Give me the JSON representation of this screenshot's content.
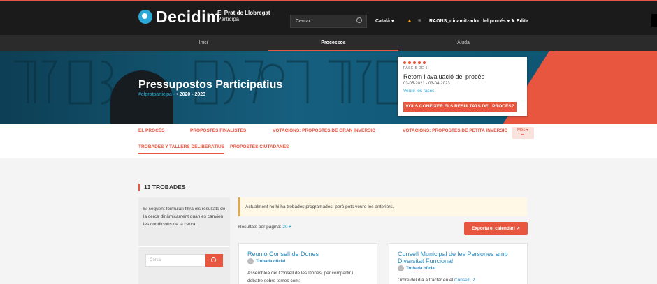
{
  "topbar": {
    "logo_text": "Decidim",
    "org_line1": "El Prat de Llobregat",
    "org_line2": "Participa",
    "search_placeholder": "Cercar",
    "language": "Català ▾",
    "user": "RAONS_dinamitzador del procés ▾ ✎ Edita",
    "colors": {
      "accent": "#e8563f",
      "bar": "#1b1b1b",
      "logo_blue": "#2aa9d6"
    }
  },
  "mainnav": [
    {
      "label": "Inici"
    },
    {
      "label": "Processos"
    },
    {
      "label": "Ajuda"
    }
  ],
  "hero": {
    "title": "Pressupostos Participatius",
    "hashtag": "#elpratparticipa",
    "years": "2020 - 2023"
  },
  "phase": {
    "label": "FASE 5 DE 5",
    "title": "Retorn i avaluació del procés",
    "dates": "03-05-2021 - 03-04-2023",
    "link": "Veure les fases",
    "button": "VOLS CONÈIXER ELS RESULTATS DEL PROCÉS?"
  },
  "subnav": {
    "tabs": [
      {
        "label": "EL PROCÉS"
      },
      {
        "label": "PROPOSTES FINALISTES"
      },
      {
        "label": "VOTACIONS: PROPOSTES DE GRAN INVERSIÓ"
      },
      {
        "label": "VOTACIONS: PROPOSTES DE PETITA INVERSIÓ"
      },
      {
        "label": "TROBADES Y TALLERS DELIBERATIUS"
      },
      {
        "label": "PROPOSTES CIUTADANES"
      }
    ],
    "more": "Més ▾"
  },
  "content": {
    "count_title": "13 TROBADES",
    "filter_description": "El següent formulari filtra els resultats de la cerca dinàmicament quan es canvien les condicions de la cerca.",
    "filter_search_placeholder": "Cerca",
    "notice": "Actualment no hi ha trobades programades, però pots veure les anteriors.",
    "per_page_label": "Resultats per pàgina:",
    "per_page_value": "20 ▾",
    "export_button": "Exporta el calendari ↗",
    "cards": [
      {
        "title": "Reunió Consell de Dones",
        "tag": "Trobada oficial",
        "desc": "Assemblea del Consell de les Dones, per compartir i debatre sobre temes com:"
      },
      {
        "title": "Consell Municipal de les Persones amb Diversitat Funcional",
        "tag": "Trobada oficial",
        "desc_prefix": "Ordre del dia a tractar en el ",
        "desc_link": "Consell: ↗"
      }
    ]
  }
}
